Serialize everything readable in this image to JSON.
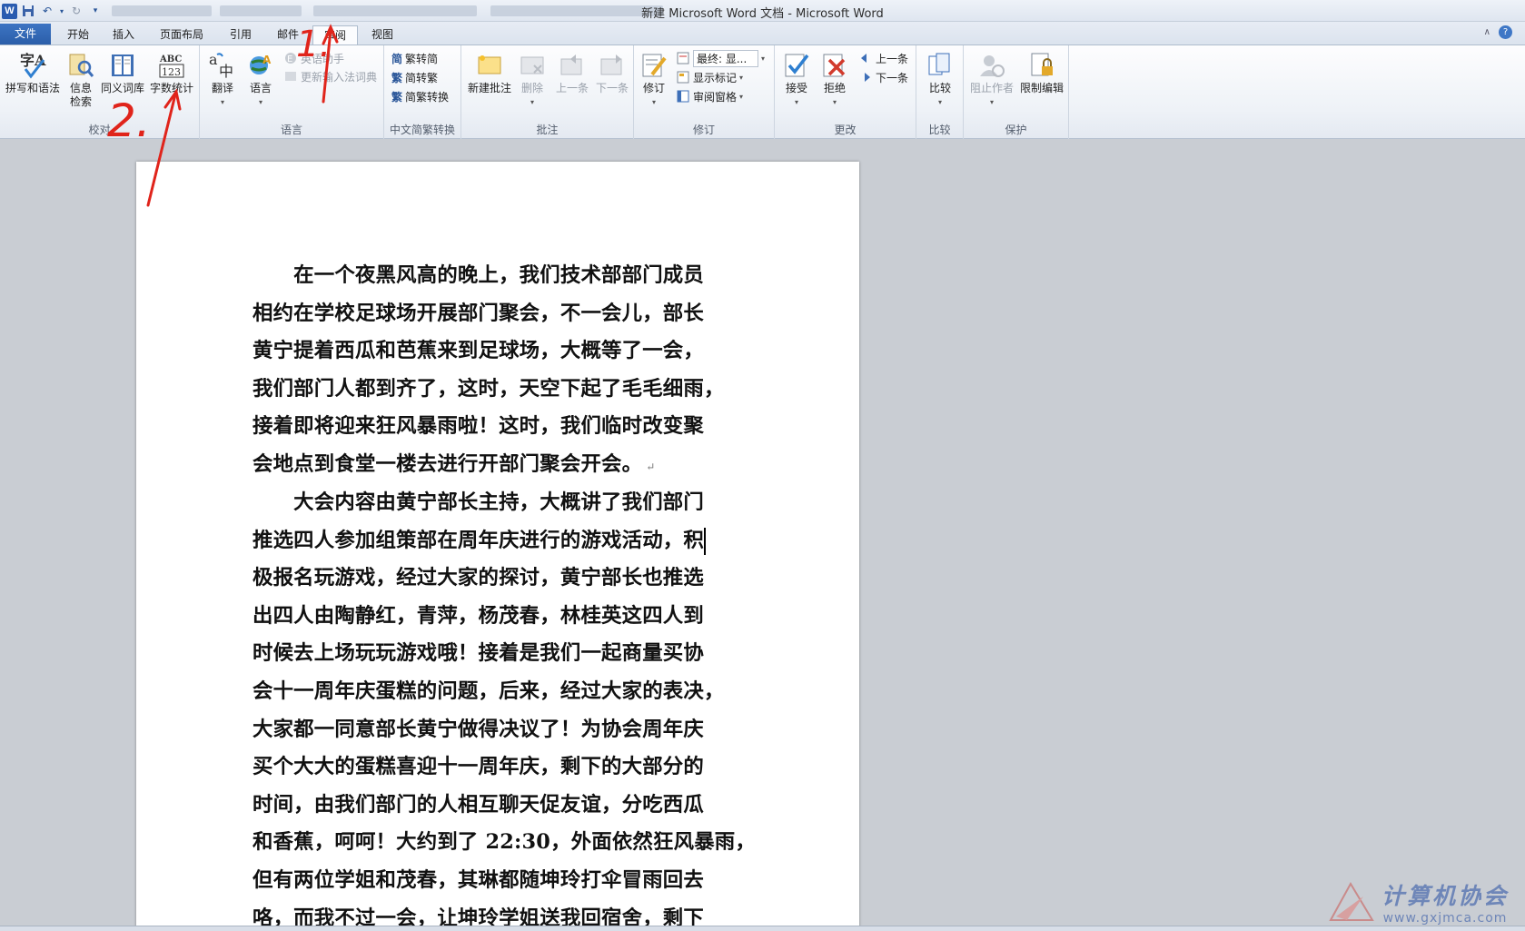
{
  "window": {
    "title": "新建 Microsoft Word 文档 - Microsoft Word"
  },
  "tabs": [
    {
      "label": "文件"
    },
    {
      "label": "开始"
    },
    {
      "label": "插入"
    },
    {
      "label": "页面布局"
    },
    {
      "label": "引用"
    },
    {
      "label": "邮件"
    },
    {
      "label": "审阅"
    },
    {
      "label": "视图"
    }
  ],
  "ribbon": {
    "proofing": {
      "label": "校对",
      "spelling": "拼写和语法",
      "research_1": "信息",
      "research_2": "检索",
      "thesaurus": "同义词库",
      "word_count": "字数统计"
    },
    "language": {
      "label": "语言",
      "translate": "翻译",
      "language": "语言",
      "ime_1": "英语助手",
      "ime_2": "更新输入法词典"
    },
    "chinese": {
      "label": "中文简繁转换",
      "to_simplified": "繁转简",
      "to_traditional": "简转繁",
      "convert": "简繁转换"
    },
    "comments": {
      "label": "批注",
      "new": "新建批注",
      "delete": "删除",
      "prev": "上一条",
      "next": "下一条"
    },
    "tracking": {
      "label": "修订",
      "track": "修订",
      "display_value": "最终: 显...",
      "show_markup": "显示标记",
      "reviewing_pane": "审阅窗格"
    },
    "changes": {
      "label": "更改",
      "accept": "接受",
      "reject": "拒绝",
      "prev": "上一条",
      "next": "下一条"
    },
    "compare": {
      "label": "比较",
      "compare": "比较"
    },
    "protect": {
      "label": "保护",
      "block_authors": "阻止作者",
      "restrict": "限制编辑"
    }
  },
  "document": {
    "para1": [
      "　　在一个夜黑风高的晚上，我们技术部部门成员",
      "相约在学校足球场开展部门聚会，不一会儿，部长",
      "黄宁提着西瓜和芭蕉来到足球场，大概等了一会，",
      "我们部门人都到齐了，这时，天空下起了毛毛细雨，",
      "接着即将迎来狂风暴雨啦！这时，我们临时改变聚",
      "会地点到食堂一楼去进行开部门聚会开会。"
    ],
    "para2": [
      "　　大会内容由黄宁部长主持，大概讲了我们部门",
      "推选四人参加组策部在周年庆进行的游戏活动，积",
      "极报名玩游戏，经过大家的探讨，黄宁部长也推选",
      "出四人由陶静红，青萍，杨茂春，林桂英这四人到",
      "时候去上场玩玩游戏哦！接着是我们一起商量买协",
      "会十一周年庆蛋糕的问题，后来，经过大家的表决，",
      "大家都一同意部长黄宁做得决议了！为协会周年庆",
      "买个大大的蛋糕喜迎十一周年庆，剩下的大部分的",
      "时间，由我们部门的人相互聊天促友谊，分吃西瓜",
      "和香蕉，呵呵！大约到了 22:30，外面依然狂风暴雨，",
      "但有两位学姐和茂春，其琳都随坤玲打伞冒雨回去",
      "咯，而我不过一会，让坤玲学姐送我回宿舍，剩下"
    ]
  },
  "annotations": {
    "step1": "1.",
    "step2": "2."
  },
  "watermark": {
    "title": "计算机协会",
    "url": "www.gxjmca.com"
  }
}
